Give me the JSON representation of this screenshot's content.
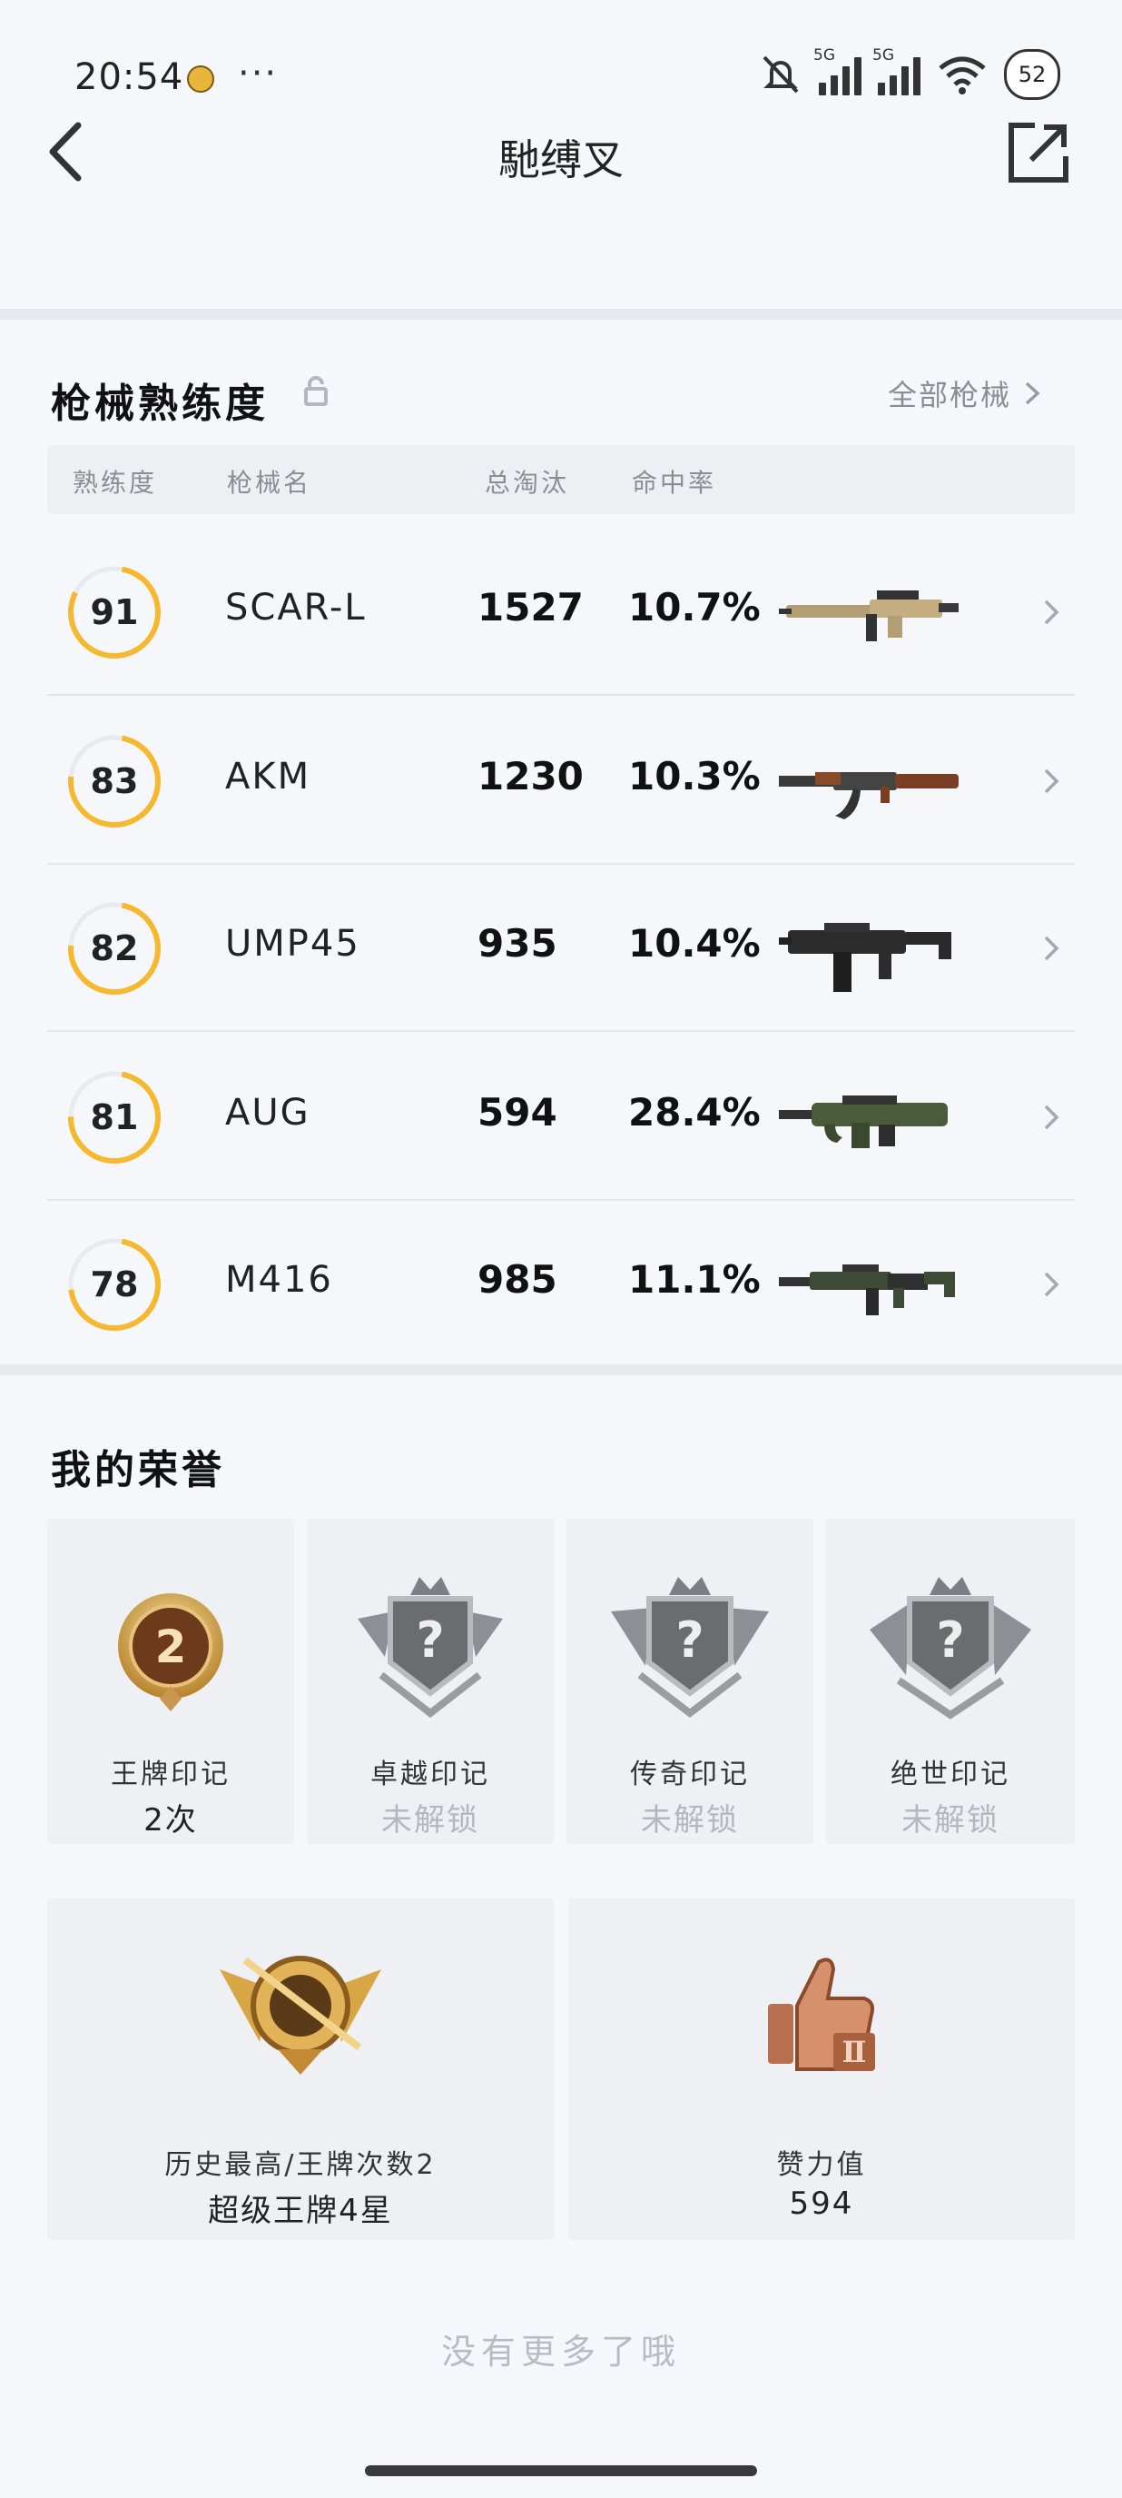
{
  "status_bar": {
    "time": "20:54",
    "dots": "···",
    "network_1": "5G",
    "network_2": "5G",
    "battery": "52"
  },
  "header": {
    "title": "馳缚叉"
  },
  "weapons": {
    "section_title": "枪械熟练度",
    "all_link": "全部枪械",
    "columns": [
      "熟练度",
      "枪械名",
      "总淘汰",
      "命中率"
    ],
    "rows": [
      {
        "proficiency": "91",
        "name": "SCAR-L",
        "kills": "1527",
        "accuracy": "10.7%",
        "icon": "scar-l-gun-icon"
      },
      {
        "proficiency": "83",
        "name": "AKM",
        "kills": "1230",
        "accuracy": "10.3%",
        "icon": "akm-gun-icon"
      },
      {
        "proficiency": "82",
        "name": "UMP45",
        "kills": "935",
        "accuracy": "10.4%",
        "icon": "ump45-gun-icon"
      },
      {
        "proficiency": "81",
        "name": "AUG",
        "kills": "594",
        "accuracy": "28.4%",
        "icon": "aug-gun-icon"
      },
      {
        "proficiency": "78",
        "name": "M416",
        "kills": "985",
        "accuracy": "11.1%",
        "icon": "m416-gun-icon"
      }
    ],
    "ring_color": "#f5b82e"
  },
  "honors": {
    "section_title": "我的荣誉",
    "cards": [
      {
        "label": "王牌印记",
        "value": "2次",
        "locked": false,
        "badge_text": "2"
      },
      {
        "label": "卓越印记",
        "value": "未解锁",
        "locked": true,
        "badge_text": "?"
      },
      {
        "label": "传奇印记",
        "value": "未解锁",
        "locked": true,
        "badge_text": "?"
      },
      {
        "label": "绝世印记",
        "value": "未解锁",
        "locked": true,
        "badge_text": "?"
      }
    ],
    "wide_cards": [
      {
        "label": "历史最高/王牌次数2",
        "value": "超级王牌4星"
      },
      {
        "label": "赞力值",
        "value": "594"
      }
    ]
  },
  "footer": {
    "no_more": "没有更多了哦"
  }
}
